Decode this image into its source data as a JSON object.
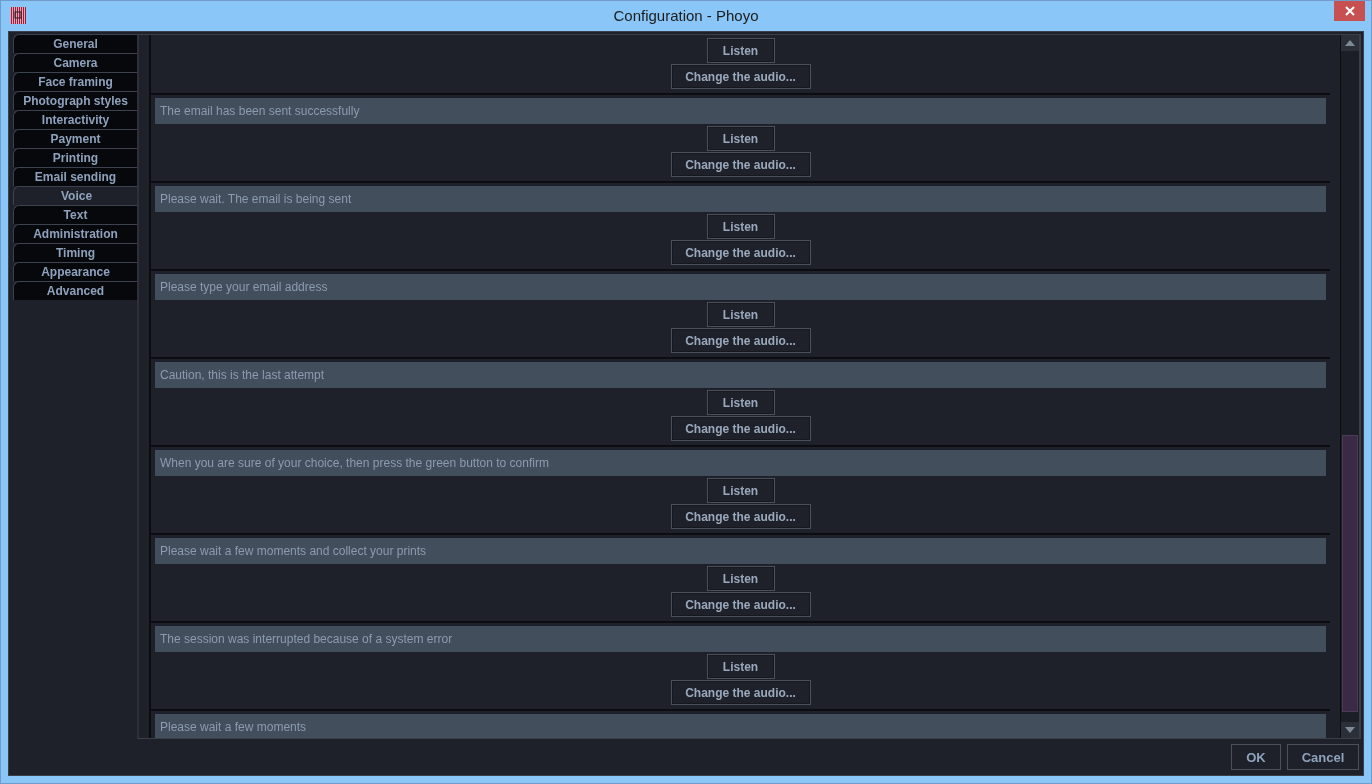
{
  "window": {
    "title": "Configuration - Phoyo"
  },
  "tabs": [
    {
      "label": "General",
      "selected": false
    },
    {
      "label": "Camera",
      "selected": false
    },
    {
      "label": "Face framing",
      "selected": false
    },
    {
      "label": "Photograph styles",
      "selected": false
    },
    {
      "label": "Interactivity",
      "selected": false
    },
    {
      "label": "Payment",
      "selected": false
    },
    {
      "label": "Printing",
      "selected": false
    },
    {
      "label": "Email sending",
      "selected": false
    },
    {
      "label": "Voice",
      "selected": true
    },
    {
      "label": "Text",
      "selected": false
    },
    {
      "label": "Administration",
      "selected": false
    },
    {
      "label": "Timing",
      "selected": false
    },
    {
      "label": "Appearance",
      "selected": false
    },
    {
      "label": "Advanced",
      "selected": false
    }
  ],
  "messages": [
    {
      "listen": "Listen",
      "change": "Change the audio..."
    },
    {
      "label": "The email has been sent successfully",
      "listen": "Listen",
      "change": "Change the audio..."
    },
    {
      "label": "Please wait. The email is being sent",
      "listen": "Listen",
      "change": "Change the audio..."
    },
    {
      "label": "Please type your email address",
      "listen": "Listen",
      "change": "Change the audio..."
    },
    {
      "label": "Caution, this is the last attempt",
      "listen": "Listen",
      "change": "Change the audio..."
    },
    {
      "label": "When you are sure of your choice, then press the green button to confirm",
      "listen": "Listen",
      "change": "Change the audio..."
    },
    {
      "label": "Please wait a few moments and collect your prints",
      "listen": "Listen",
      "change": "Change the audio..."
    },
    {
      "label": "The session was interrupted because of a system error",
      "listen": "Listen",
      "change": "Change the audio..."
    },
    {
      "label": "Please wait a few moments"
    }
  ],
  "buttons": [
    "OK",
    "Cancel"
  ]
}
